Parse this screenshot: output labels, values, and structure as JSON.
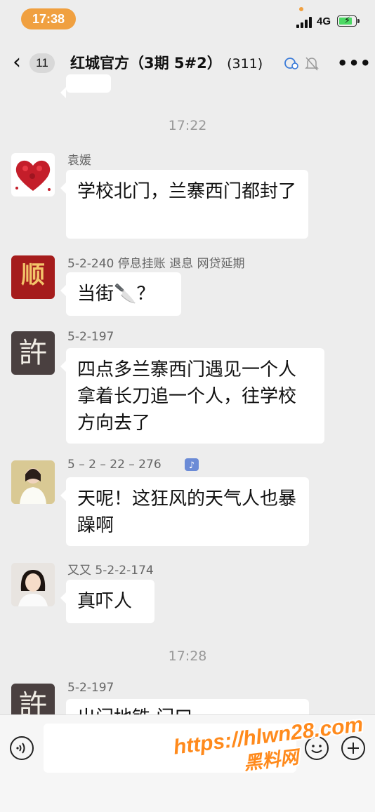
{
  "status": {
    "time": "17:38",
    "network": "4G"
  },
  "header": {
    "back_count": "11",
    "title": "红城官方（3期 5#2）",
    "member_count": "(311)"
  },
  "timestamps": [
    "17:22",
    "17:28"
  ],
  "messages": [
    {
      "sender": "袁媛",
      "text": "学校北门，兰寨西门都封了"
    },
    {
      "sender": "5-2-240 停息挂账 退息 网贷延期",
      "text": "当街🔪？",
      "avatar_text": "顺"
    },
    {
      "sender": "5-2-197",
      "text": "四点多兰寨西门遇见一个人拿着长刀追一个人，往学校方向去了",
      "avatar_text": "許"
    },
    {
      "sender": "5 – 2 – 22 – 276",
      "text": "天呢！这狂风的天气人也暴躁啊"
    },
    {
      "sender": "又又 5-2-2-174",
      "text": "真吓人"
    },
    {
      "sender": "5-2-197",
      "text": "出门地铁 门口...",
      "avatar_text": "許"
    }
  ],
  "input": {
    "placeholder": ""
  },
  "watermark": {
    "url": "https://hlwn28.com",
    "brand": "黑料网"
  },
  "colors": {
    "accent": "#f0a040",
    "bubble": "#ffffff",
    "background": "#ededed"
  }
}
